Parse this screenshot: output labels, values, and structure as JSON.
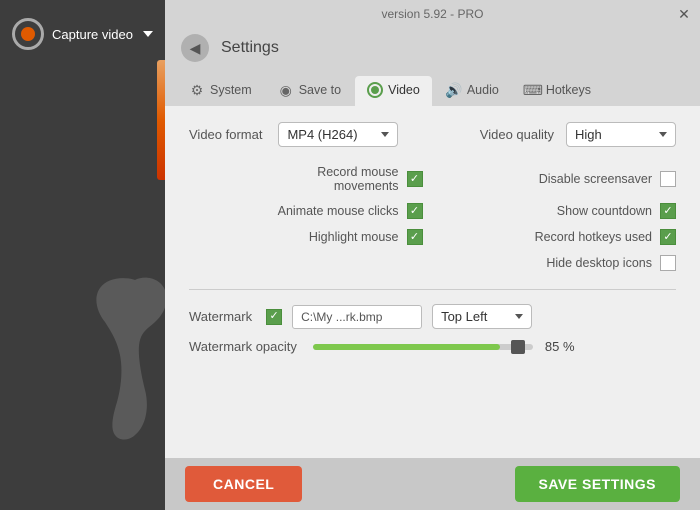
{
  "app": {
    "version": "version 5.92 - PRO"
  },
  "sidebar": {
    "capture_label": "Capture video",
    "chevron": "▾"
  },
  "header": {
    "back_icon": "◀",
    "title": "Settings",
    "close_icon": "✕"
  },
  "tabs": [
    {
      "id": "system",
      "label": "System",
      "icon": "⚙"
    },
    {
      "id": "saveto",
      "label": "Save to",
      "icon": "💾"
    },
    {
      "id": "video",
      "label": "Video",
      "icon": "●",
      "active": true
    },
    {
      "id": "audio",
      "label": "Audio",
      "icon": "🔊"
    },
    {
      "id": "hotkeys",
      "label": "Hotkeys",
      "icon": "⌨"
    }
  ],
  "video": {
    "format_label": "Video format",
    "format_value": "MP4 (H264)",
    "quality_label": "Video quality",
    "quality_value": "High",
    "settings": {
      "left": [
        {
          "id": "record-mouse",
          "label": "Record mouse\nmovements",
          "checked": true
        },
        {
          "id": "animate-clicks",
          "label": "Animate mouse clicks",
          "checked": true
        },
        {
          "id": "highlight-mouse",
          "label": "Highlight mouse",
          "checked": true
        }
      ],
      "right": [
        {
          "id": "disable-screensaver",
          "label": "Disable screensaver",
          "checked": false
        },
        {
          "id": "show-countdown",
          "label": "Show countdown",
          "checked": true
        },
        {
          "id": "record-hotkeys",
          "label": "Record hotkeys used",
          "checked": true
        },
        {
          "id": "hide-desktop",
          "label": "Hide desktop icons",
          "checked": false
        }
      ]
    },
    "watermark": {
      "label": "Watermark",
      "checked": true,
      "path": "C:\\My ...rk.bmp",
      "position_label": "Top Left"
    },
    "opacity": {
      "label": "Watermark opacity",
      "value": "85 %",
      "percent": 85
    }
  },
  "buttons": {
    "cancel": "CANCEL",
    "save": "SAVE SETTINGS"
  }
}
